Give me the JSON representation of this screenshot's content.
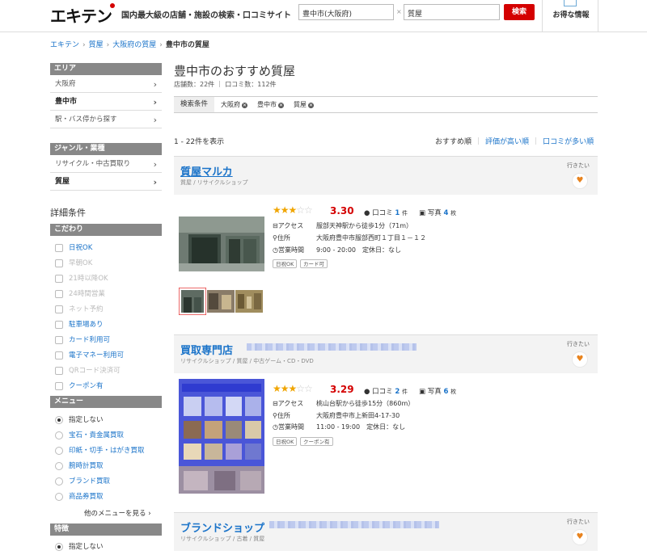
{
  "header": {
    "logo": "エキテン",
    "tagline": "国内最大級の店舗・施設の検索・口コミサイト",
    "area_value": "豊中市(大阪府)",
    "separator": "×",
    "keyword_value": "質屋",
    "search_label": "検索",
    "deals_label": "お得な情報"
  },
  "breadcrumb": [
    "エキテン",
    "質屋",
    "大阪府の質屋",
    "豊中市の質屋"
  ],
  "breadcrumb_sep": "›",
  "sidebar": {
    "area_head": "エリア",
    "area_items": [
      "大阪府",
      "豊中市",
      "駅・バス停から探す"
    ],
    "genre_head": "ジャンル・業種",
    "genre_items": [
      "リサイクル・中古買取り",
      "質屋"
    ],
    "detail_title": "詳細条件",
    "kodawari_head": "こだわり",
    "kodawari_items": [
      {
        "label": "日祝OK",
        "state": "on"
      },
      {
        "label": "早朝OK",
        "state": "off"
      },
      {
        "label": "21時以降OK",
        "state": "off"
      },
      {
        "label": "24時間営業",
        "state": "off"
      },
      {
        "label": "ネット予約",
        "state": "off"
      },
      {
        "label": "駐車場あり",
        "state": "on"
      },
      {
        "label": "カード利用可",
        "state": "on"
      },
      {
        "label": "電子マネー利用可",
        "state": "on"
      },
      {
        "label": "QRコード決済可",
        "state": "off"
      },
      {
        "label": "クーポン有",
        "state": "on"
      }
    ],
    "menu_head": "メニュー",
    "menu_items": [
      "指定しない",
      "宝石・貴金属買取",
      "印紙・切手・はがき買取",
      "腕時計買取",
      "ブランド買取",
      "商品券買取"
    ],
    "more_menu": "他のメニューを見る ›",
    "tokucho_head": "特徴",
    "tokucho_items": [
      "指定しない"
    ]
  },
  "main": {
    "title": "豊中市のおすすめ質屋",
    "counts": "店舗数：22件 ｜ 口コミ数：112件",
    "filter_label": "検索条件",
    "chips": [
      "大阪府",
      "豊中市",
      "質屋"
    ],
    "result_range": "1 - 22件を表示",
    "sort": [
      "おすすめ順",
      "評価が高い順",
      "口コミが多い順"
    ],
    "sort_sep": "｜"
  },
  "listings": [
    {
      "name": "質屋マルカ",
      "category": "質屋 / リサイクルショップ",
      "want": "行きたい",
      "rating": 3.3,
      "score": "3.30",
      "reviews_label": "口コミ",
      "reviews": "1",
      "reviews_unit": "件",
      "photos_label": "写真",
      "photos": "4",
      "photos_unit": "枚",
      "access_label": "アクセス",
      "access": "服部天神駅から徒歩1分（71m）",
      "address_label": "住所",
      "address": "大阪府豊中市服部西町１丁目１－１２",
      "hours_label": "営業時間",
      "hours": "9:00 - 20:00　定休日：なし",
      "tags": [
        "日祝OK",
        "カード可"
      ]
    },
    {
      "name": "買取専門店",
      "category": "リサイクルショップ / 質屋 / 中古ゲーム・CD・DVD",
      "want": "行きたい",
      "rating": 3.29,
      "score": "3.29",
      "reviews_label": "口コミ",
      "reviews": "2",
      "reviews_unit": "件",
      "photos_label": "写真",
      "photos": "6",
      "photos_unit": "枚",
      "access_label": "アクセス",
      "access": "桃山台駅から徒歩15分（860m）",
      "address_label": "住所",
      "address": "大阪府豊中市上新田4-17-30",
      "hours_label": "営業時間",
      "hours": "11:00 - 19:00　定休日：なし",
      "tags": [
        "日祝OK",
        "クーポン有"
      ]
    },
    {
      "name": "ブランドショップ",
      "category": "リサイクルショップ / 古着 / 質屋",
      "want": "行きたい"
    }
  ],
  "icons": {
    "chevron": "chevron-right-icon",
    "heart": "heart-icon",
    "star": "star-icon",
    "comment": "comment-icon",
    "camera": "camera-icon",
    "train": "train-icon",
    "pin": "pin-icon",
    "clock": "clock-icon"
  },
  "colors": {
    "accent": "#d40000",
    "link": "#1a73c9",
    "star": "#f0a500",
    "heart": "#e8831e",
    "sidebar_head": "#888888"
  }
}
